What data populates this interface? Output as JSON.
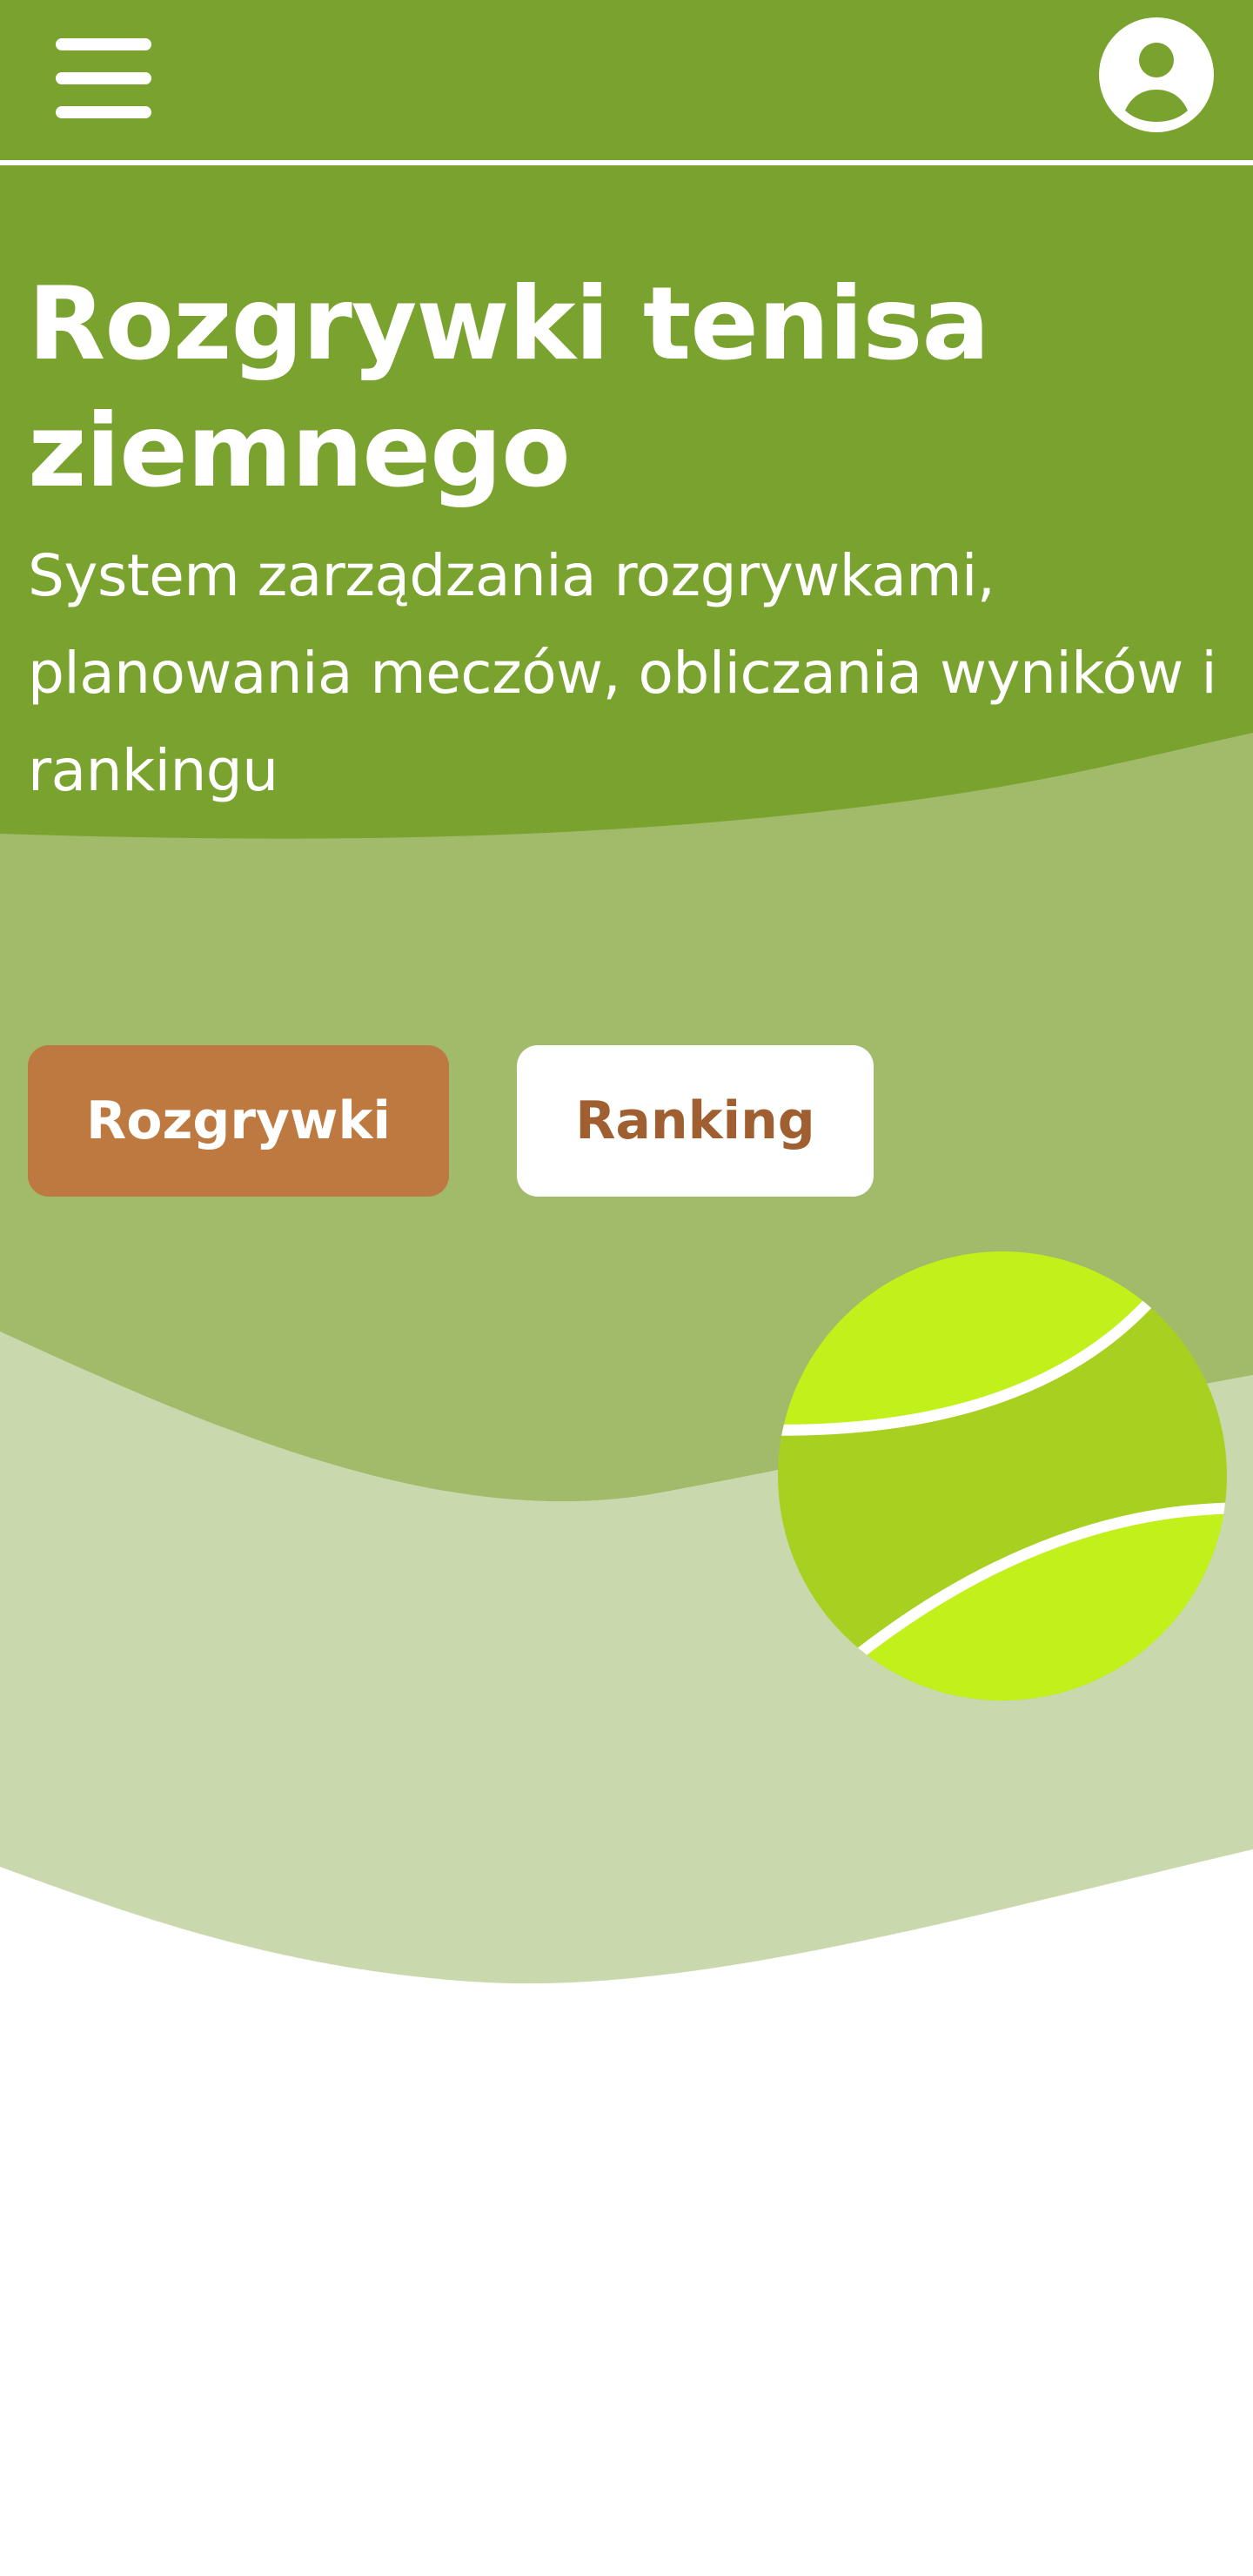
{
  "header": {
    "menu_icon": "hamburger-menu-icon",
    "account_icon": "user-account-icon"
  },
  "hero": {
    "title": "Rozgrywki tenisa ziemnego",
    "subtitle": "System zarządzania rozgrywkami, planowania meczów, obliczania wyników i rankingu",
    "decoration_icon": "tennis-ball-icon"
  },
  "actions": {
    "primary_label": "Rozgrywki",
    "secondary_label": "Ranking"
  },
  "colors": {
    "header_green": "#79a22f",
    "mid_green": "#a1bb6b",
    "light_green": "#c9d9ad",
    "primary_button": "#bd7940",
    "secondary_button_text": "#a05f30",
    "ball_light": "#c2f01a",
    "ball_dark": "#a8d020"
  }
}
